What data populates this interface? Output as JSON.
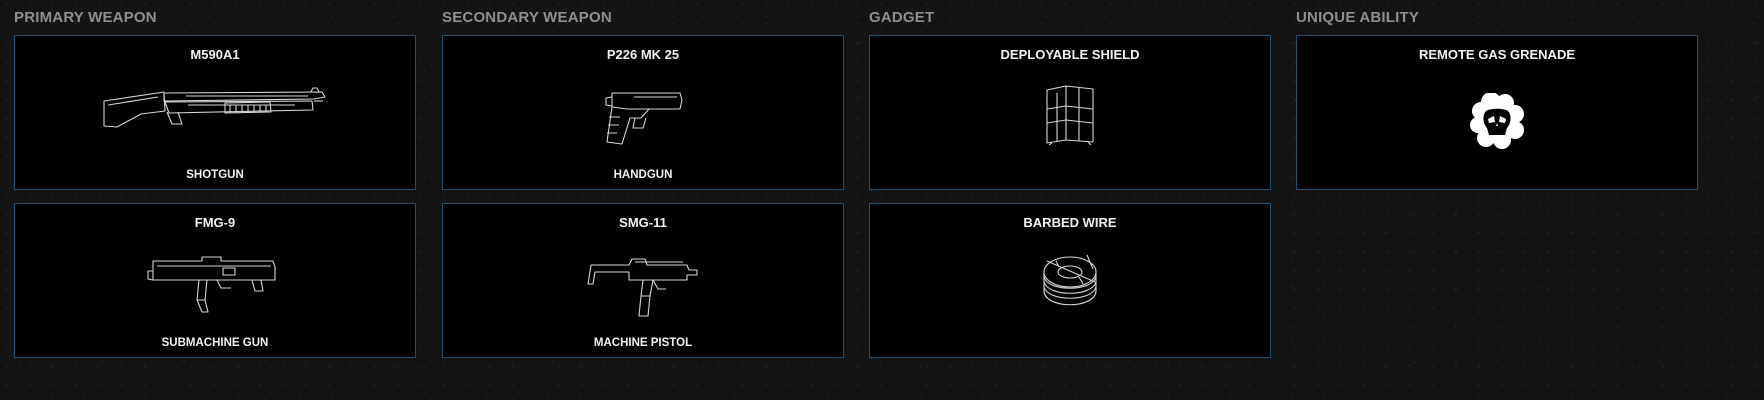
{
  "sections": {
    "primary": {
      "title": "PRIMARY WEAPON",
      "items": [
        {
          "name": "M590A1",
          "type": "SHOTGUN",
          "icon": "shotgun-icon"
        },
        {
          "name": "FMG-9",
          "type": "SUBMACHINE GUN",
          "icon": "submachine-gun-icon"
        }
      ]
    },
    "secondary": {
      "title": "SECONDARY WEAPON",
      "items": [
        {
          "name": "P226 MK 25",
          "type": "HANDGUN",
          "icon": "handgun-icon"
        },
        {
          "name": "SMG-11",
          "type": "MACHINE PISTOL",
          "icon": "machine-pistol-icon"
        }
      ]
    },
    "gadget": {
      "title": "GADGET",
      "items": [
        {
          "name": "DEPLOYABLE SHIELD",
          "icon": "deployable-shield-icon"
        },
        {
          "name": "BARBED WIRE",
          "icon": "barbed-wire-icon"
        }
      ]
    },
    "ability": {
      "title": "UNIQUE ABILITY",
      "items": [
        {
          "name": "REMOTE GAS GRENADE",
          "icon": "gas-grenade-icon"
        }
      ]
    }
  },
  "colors": {
    "background": "#141414",
    "card_background": "#000000",
    "card_border": "#1f4f72",
    "title_text": "#8f8f8f",
    "card_text": "#f2f2f2"
  }
}
